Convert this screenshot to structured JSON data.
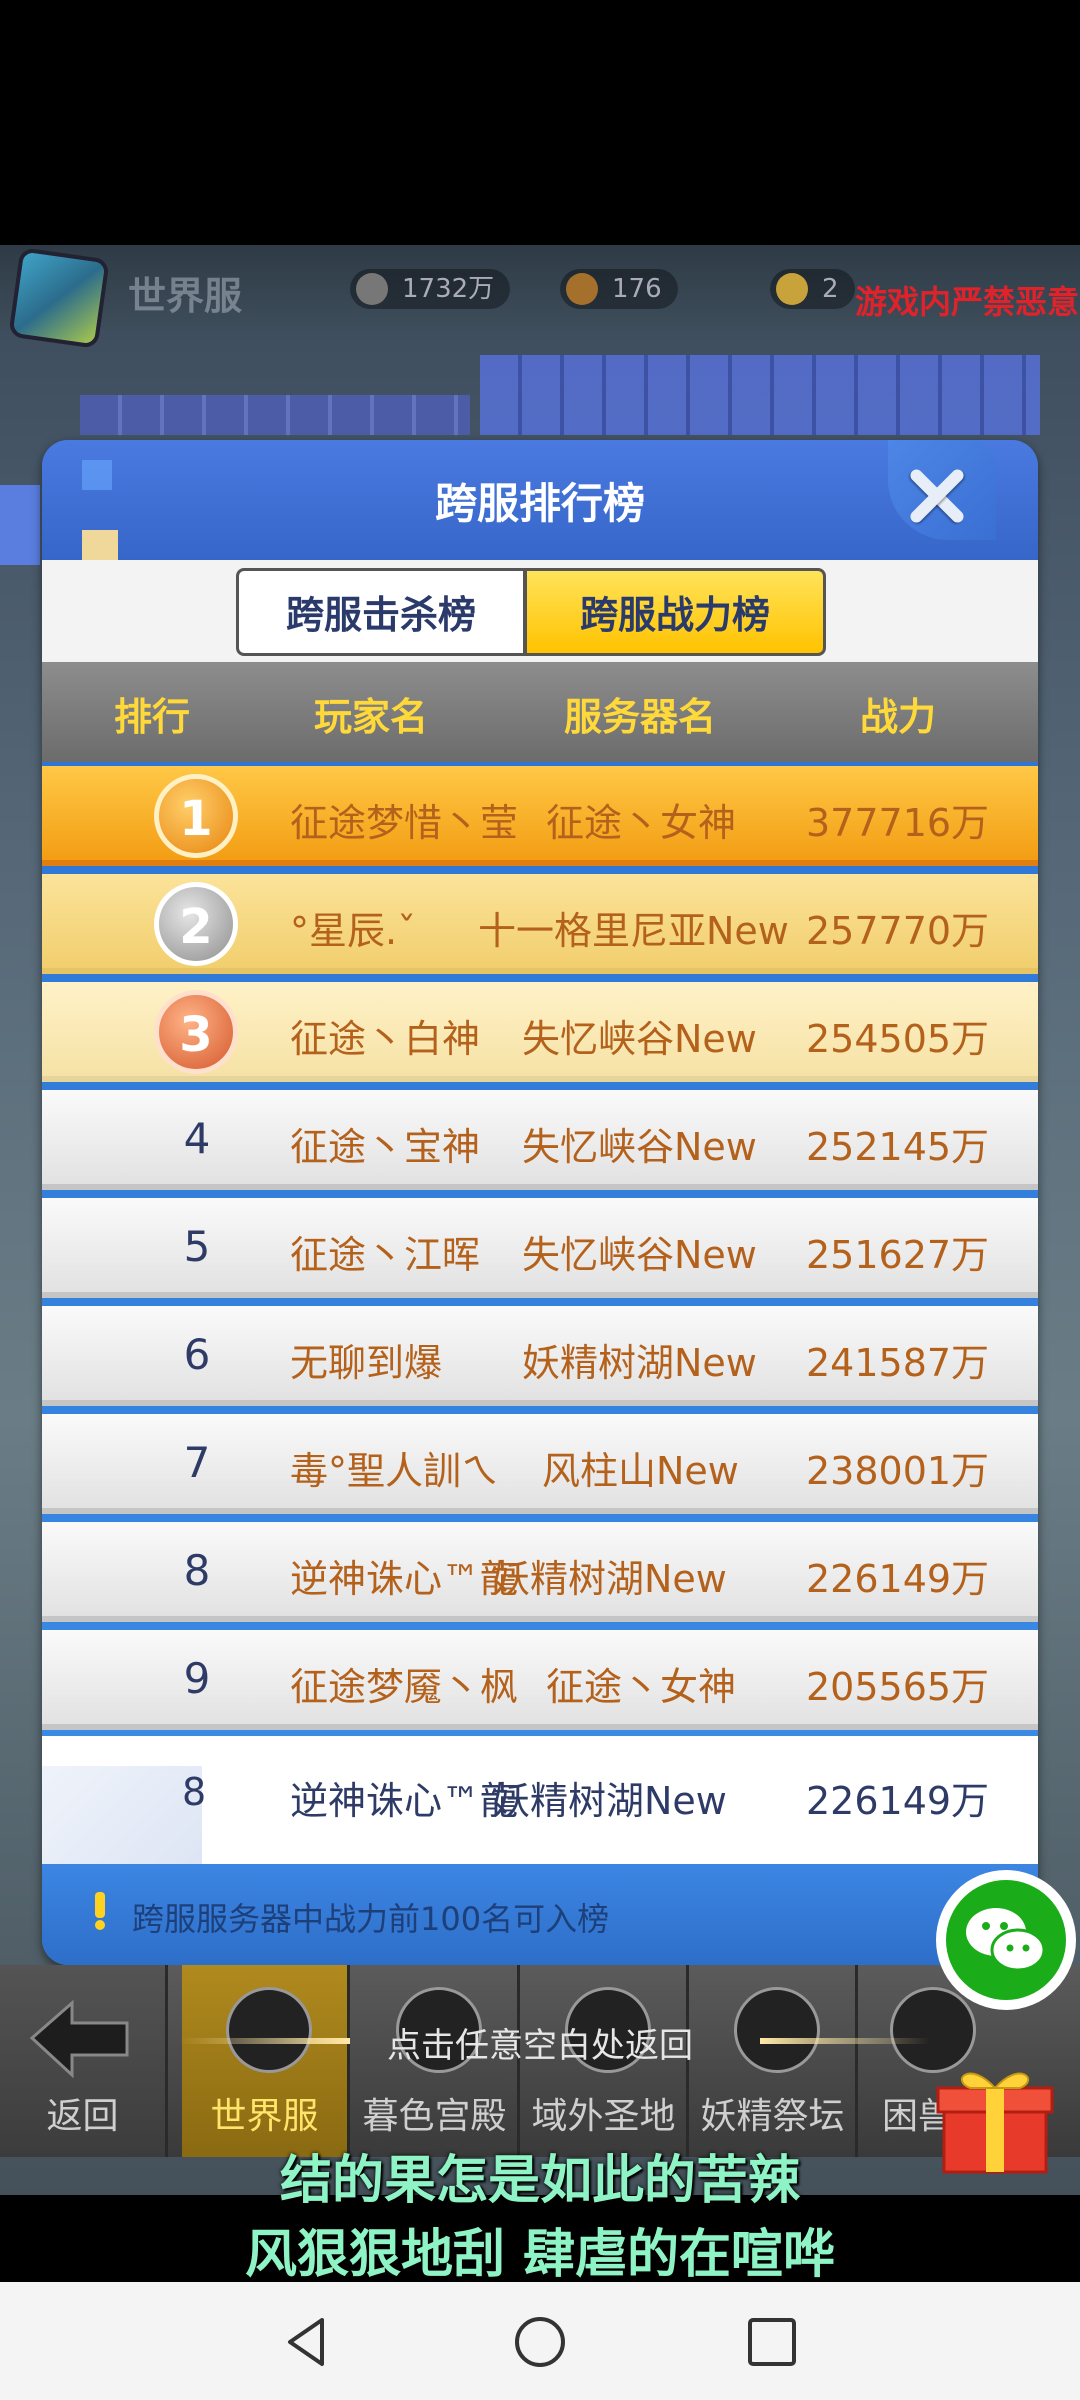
{
  "top_bar": {
    "server_label": "世界服",
    "stat_1": "1732万",
    "stat_2": "176",
    "stat_3": "2",
    "warning": "游戏内严禁恶意"
  },
  "panel": {
    "title": "跨服排行榜",
    "tabs": [
      {
        "label": "跨服击杀榜",
        "selected": false
      },
      {
        "label": "跨服战力榜",
        "selected": true
      }
    ],
    "columns": [
      "排行",
      "玩家名",
      "服务器名",
      "战力"
    ],
    "rows": [
      {
        "rank": "1",
        "player": "征途梦惜丶莹",
        "server": "征途丶女神",
        "power": "377716万"
      },
      {
        "rank": "2",
        "player": "°星辰.ˇ",
        "server": "十一格里尼亚New",
        "power": "257770万"
      },
      {
        "rank": "3",
        "player": "征途丶白神",
        "server": "失忆峡谷New",
        "power": "254505万"
      },
      {
        "rank": "4",
        "player": "征途丶宝神",
        "server": "失忆峡谷New",
        "power": "252145万"
      },
      {
        "rank": "5",
        "player": "征途丶江晖",
        "server": "失忆峡谷New",
        "power": "251627万"
      },
      {
        "rank": "6",
        "player": "无聊到爆",
        "server": "妖精树湖New",
        "power": "241587万"
      },
      {
        "rank": "7",
        "player": "毒°聖人訓ㄟ",
        "server": "风柱山New",
        "power": "238001万"
      },
      {
        "rank": "8",
        "player": "逆神诛心™龍",
        "server": "妖精树湖New",
        "power": "226149万"
      },
      {
        "rank": "9",
        "player": "征途梦魇丶枫",
        "server": "征途丶女神",
        "power": "205565万"
      }
    ],
    "my_row": {
      "rank": "8",
      "player": "逆神诛心™龍",
      "server": "妖精树湖New",
      "power": "226149万"
    },
    "note": "跨服服务器中战力前100名可入榜"
  },
  "bottom_bar": {
    "back": "返回",
    "items": [
      "世界服",
      "暮色宫殿",
      "域外圣地",
      "妖精祭坛",
      "困兽"
    ],
    "hint": "点击任意空白处返回"
  },
  "subtitles": [
    "结的果怎是如此的苦辣",
    "风狠狠地刮 肆虐的在喧哗"
  ],
  "colors": {
    "accent_yellow": "#ffc300",
    "panel_blue": "#3766c9",
    "rank_text": "#b4611c",
    "subtitle": "#8ef4c5"
  }
}
